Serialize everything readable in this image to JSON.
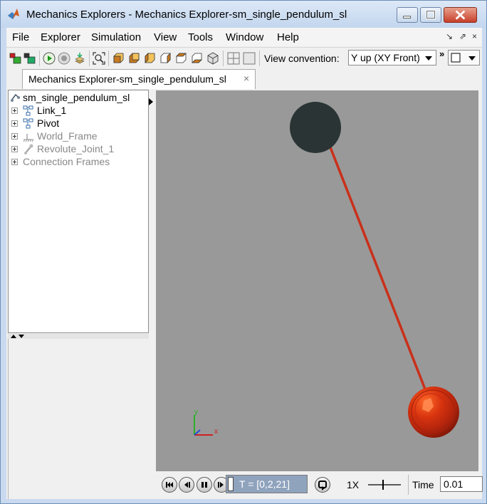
{
  "window": {
    "title": "Mechanics Explorers - Mechanics Explorer-sm_single_pendulum_sl",
    "controls": [
      "minimize-icon",
      "maximize-icon",
      "close-icon"
    ]
  },
  "menu": {
    "items": [
      "File",
      "Explorer",
      "Simulation",
      "View",
      "Tools",
      "Window",
      "Help"
    ],
    "extras": [
      "↘",
      "⇗",
      "×"
    ]
  },
  "toolbar": {
    "icons": [
      "open-model-icon",
      "save-model-icon",
      "run-icon",
      "stop-icon",
      "restore-icon",
      "fit-to-view-icon",
      "front-view-icon",
      "back-view-icon",
      "left-view-icon",
      "right-view-icon",
      "top-view-icon",
      "isometric-view-icon",
      "split-view-icon",
      "single-view-icon"
    ],
    "view_convention_label": "View convention:",
    "view_convention_value": "Y up (XY Front)",
    "overflow": "»"
  },
  "tab": {
    "label": "Mechanics Explorer-sm_single_pendulum_sl",
    "close": "×"
  },
  "tree": {
    "root": "sm_single_pendulum_sl",
    "items": [
      {
        "label": "Link_1",
        "dimmed": false
      },
      {
        "label": "Pivot",
        "dimmed": false
      },
      {
        "label": "World_Frame",
        "dimmed": true
      },
      {
        "label": "Revolute_Joint_1",
        "dimmed": true
      },
      {
        "label": "Connection Frames",
        "dimmed": true
      }
    ]
  },
  "viewport": {
    "background": "#999999",
    "pivot_color": "#2b3434",
    "link_color": "#c9301a",
    "bob_color": "#c4260f",
    "axes": {
      "x": "x",
      "y": "y"
    }
  },
  "playback": {
    "time_range": "T = [0,2,21]",
    "speed": "1X",
    "time_label": "Time",
    "time_value": "0.01"
  }
}
